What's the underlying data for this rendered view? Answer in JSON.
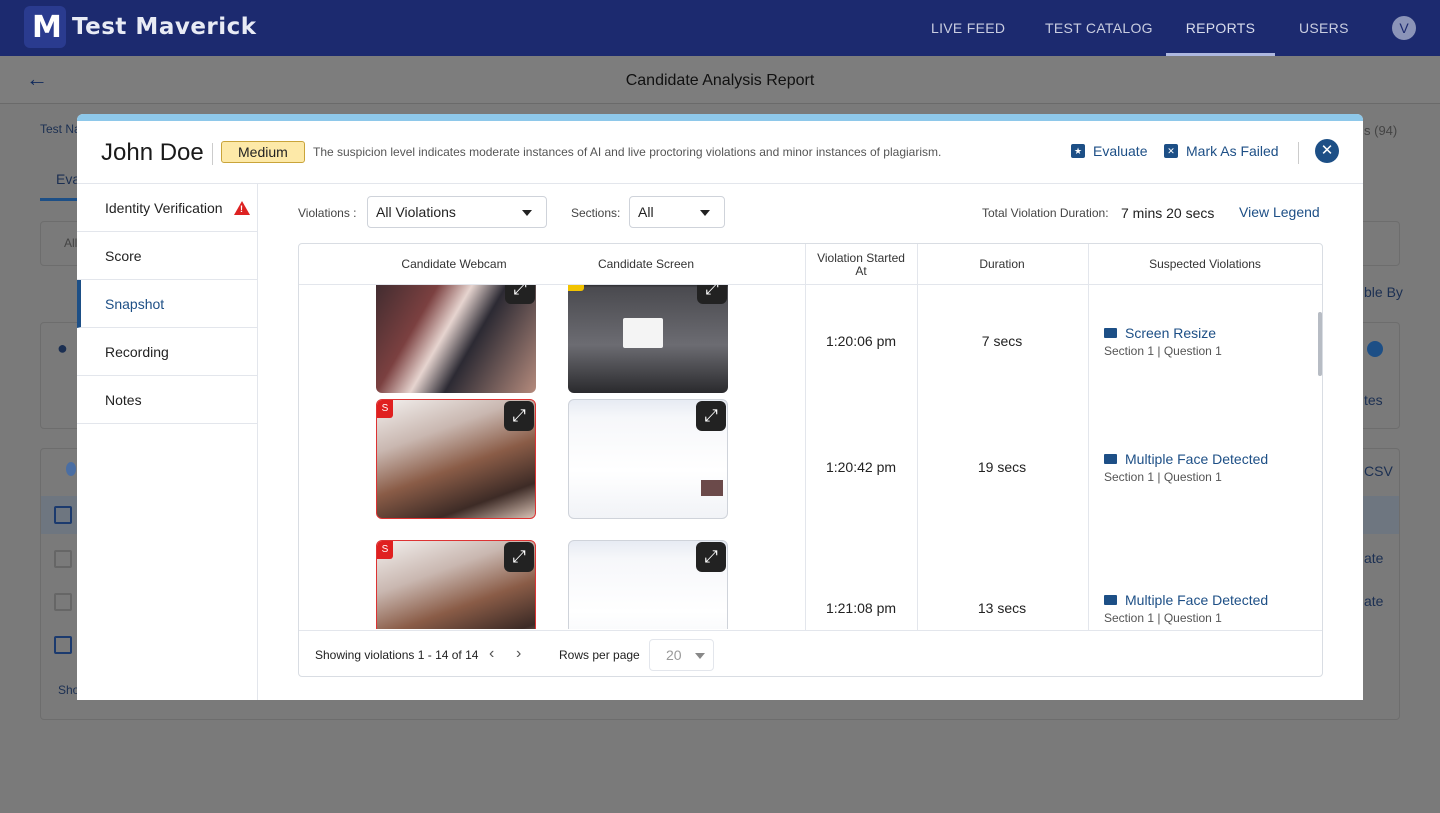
{
  "topnav": {
    "logo_text": "Test Maverick",
    "logo_mark": "M",
    "items": [
      "LIVE FEED",
      "TEST CATALOG",
      "REPORTS",
      "USERS"
    ],
    "active": "REPORTS",
    "avatar_initial": "V"
  },
  "report": {
    "title": "Candidate Analysis Report",
    "bg_fragments": {
      "test_name": "Test Na",
      "tab_eval": "Eva",
      "all_prefix": "All",
      "count": "s (94)",
      "sort_by": "ble By",
      "notes": "tes",
      "csv": "CSV",
      "evaluate_a": "ate",
      "evaluate_b": "ate",
      "show": "Sho"
    }
  },
  "modal": {
    "candidate_name": "John Doe",
    "suspicion_level": "Medium",
    "level_description": "The suspicion level indicates moderate instances of AI and live proctoring violations and minor instances of plagiarism.",
    "evaluate_label": "Evaluate",
    "mark_failed_label": "Mark As Failed",
    "close_icon": "close-icon",
    "side_menu": [
      {
        "label": "Identity Verification",
        "warning": true
      },
      {
        "label": "Score"
      },
      {
        "label": "Snapshot",
        "active": true
      },
      {
        "label": "Recording"
      },
      {
        "label": "Notes"
      }
    ],
    "filters": {
      "violations_label": "Violations :",
      "violations_value": "All Violations",
      "sections_label": "Sections:",
      "sections_value": "All",
      "total_duration_label": "Total Violation Duration:",
      "total_duration_value": "7 mins 20 secs",
      "view_legend": "View Legend"
    },
    "table": {
      "headers": [
        "Candidate Webcam",
        "Candidate Screen",
        "Violation Started At",
        "Duration",
        "Suspected Violations"
      ],
      "rows": [
        {
          "webcam_tag": "",
          "screen_tag": "M",
          "time": "1:20:06 pm",
          "duration": "7 secs",
          "violation": "Screen Resize",
          "violation_icon": "screen-resize-icon",
          "location": "Section 1 | Question 1"
        },
        {
          "webcam_tag": "S",
          "screen_tag": "",
          "time": "1:20:42 pm",
          "duration": "19 secs",
          "violation": "Multiple Face Detected",
          "violation_icon": "video-camera-icon",
          "location": "Section 1 | Question 1"
        },
        {
          "webcam_tag": "S",
          "screen_tag": "",
          "time": "1:21:08 pm",
          "duration": "13 secs",
          "violation": "Multiple Face Detected",
          "violation_icon": "video-camera-icon",
          "location": "Section 1 | Question 1"
        }
      ]
    },
    "pagination": {
      "showing": "Showing violations 1 - 14 of 14",
      "rows_per_page_label": "Rows per page",
      "rows_per_page_value": "20"
    }
  }
}
